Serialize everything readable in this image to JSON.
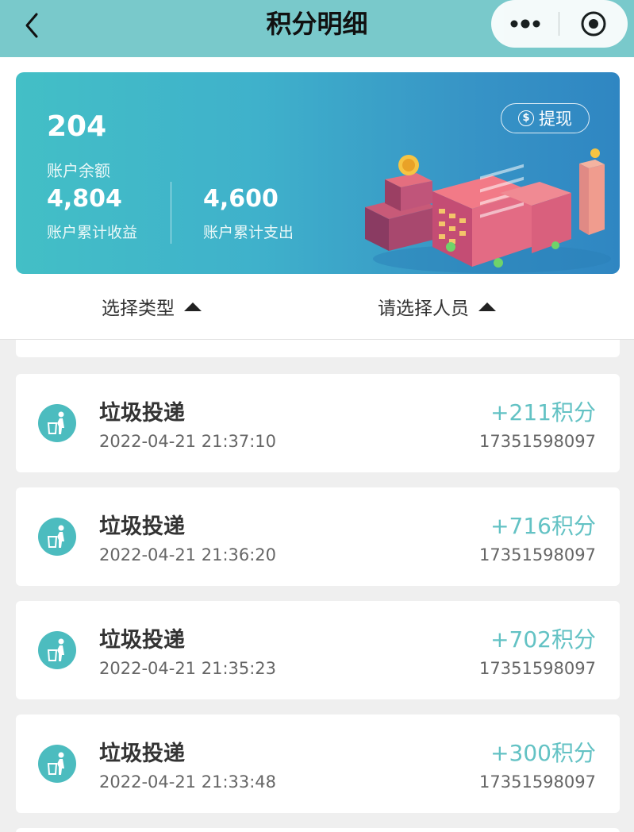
{
  "nav": {
    "title": "积分明细",
    "back_icon": "chevron-left-icon",
    "more_icon": "more-dots-icon",
    "close_icon": "target-close-icon"
  },
  "summary": {
    "balance_value": "204",
    "balance_label": "账户余额",
    "income_value": "4,804",
    "income_label": "账户累计收益",
    "expense_value": "4,600",
    "expense_label": "账户累计支出",
    "withdraw_label": "提现",
    "withdraw_icon_glyph": "$"
  },
  "filters": {
    "type_label": "选择类型",
    "person_label": "请选择人员"
  },
  "records": [
    {
      "title": "垃圾投递",
      "time": "2022-04-21 21:37:10",
      "points": "+211积分",
      "phone": "17351598097"
    },
    {
      "title": "垃圾投递",
      "time": "2022-04-21 21:36:20",
      "points": "+716积分",
      "phone": "17351598097"
    },
    {
      "title": "垃圾投递",
      "time": "2022-04-21 21:35:23",
      "points": "+702积分",
      "phone": "17351598097"
    },
    {
      "title": "垃圾投递",
      "time": "2022-04-21 21:33:48",
      "points": "+300积分",
      "phone": "17351598097"
    }
  ],
  "colors": {
    "nav_bg": "#79c9cb",
    "accent": "#63c2c4",
    "icon_bg": "#4cbcbf",
    "banner_start": "#43bfc6",
    "banner_end": "#2f86c2",
    "page_bg": "#efefef"
  }
}
